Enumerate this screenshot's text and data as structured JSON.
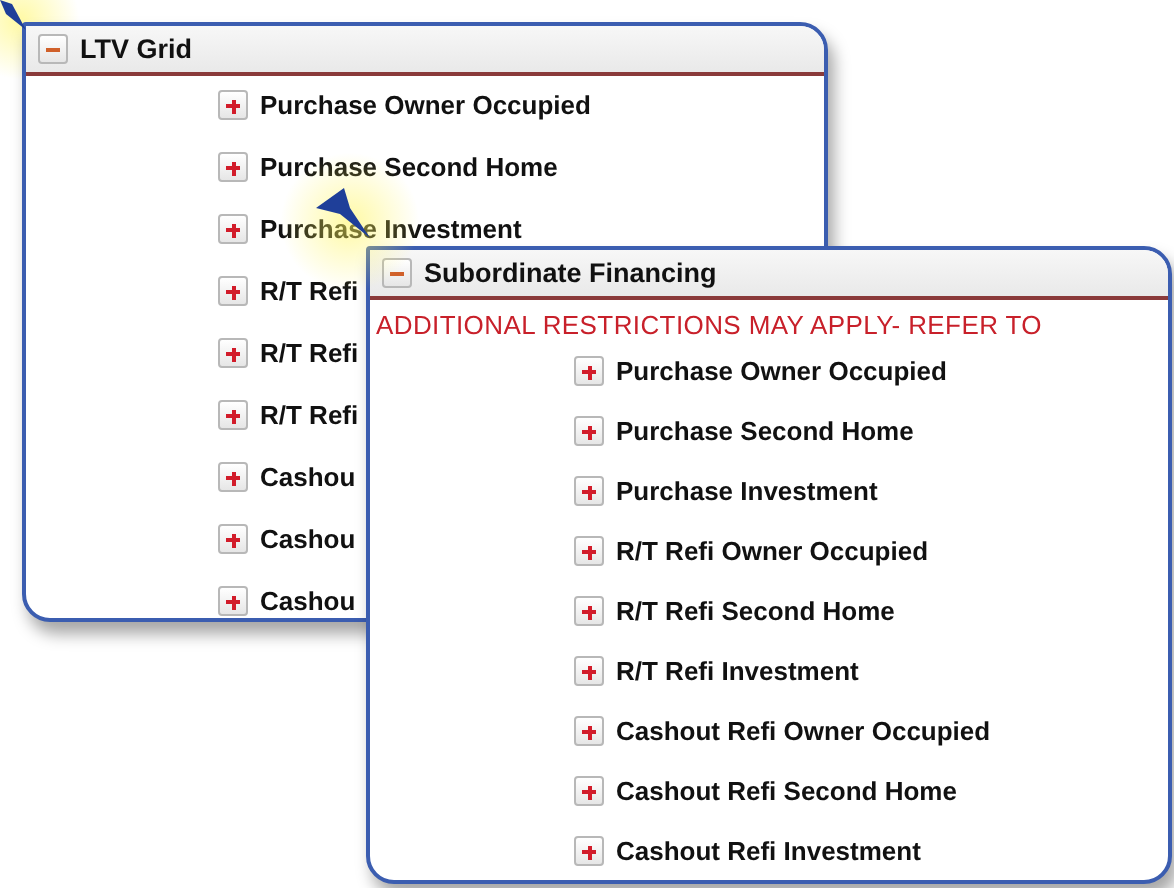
{
  "panels": [
    {
      "title": "LTV Grid",
      "expanded": true,
      "items": [
        {
          "label": "Purchase Owner Occupied",
          "expanded": false
        },
        {
          "label": "Purchase Second Home",
          "expanded": false
        },
        {
          "label": "Purchase Investment",
          "expanded": false
        },
        {
          "label": "R/T Refi",
          "expanded": false
        },
        {
          "label": "R/T Refi",
          "expanded": false
        },
        {
          "label": "R/T Refi",
          "expanded": false
        },
        {
          "label": "Cashou",
          "expanded": false
        },
        {
          "label": "Cashou",
          "expanded": false
        },
        {
          "label": "Cashou",
          "expanded": false
        }
      ]
    },
    {
      "title": "Subordinate Financing",
      "expanded": true,
      "notice": "ADDITIONAL RESTRICTIONS MAY APPLY- REFER TO",
      "items": [
        {
          "label": "Purchase Owner Occupied",
          "expanded": false
        },
        {
          "label": "Purchase Second Home",
          "expanded": false
        },
        {
          "label": "Purchase Investment",
          "expanded": false
        },
        {
          "label": "R/T Refi Owner Occupied",
          "expanded": false
        },
        {
          "label": "R/T Refi Second Home",
          "expanded": false
        },
        {
          "label": "R/T Refi Investment",
          "expanded": false
        },
        {
          "label": "Cashout Refi Owner Occupied",
          "expanded": false
        },
        {
          "label": "Cashout Refi Second Home",
          "expanded": false
        },
        {
          "label": "Cashout Refi Investment",
          "expanded": false
        }
      ]
    }
  ]
}
